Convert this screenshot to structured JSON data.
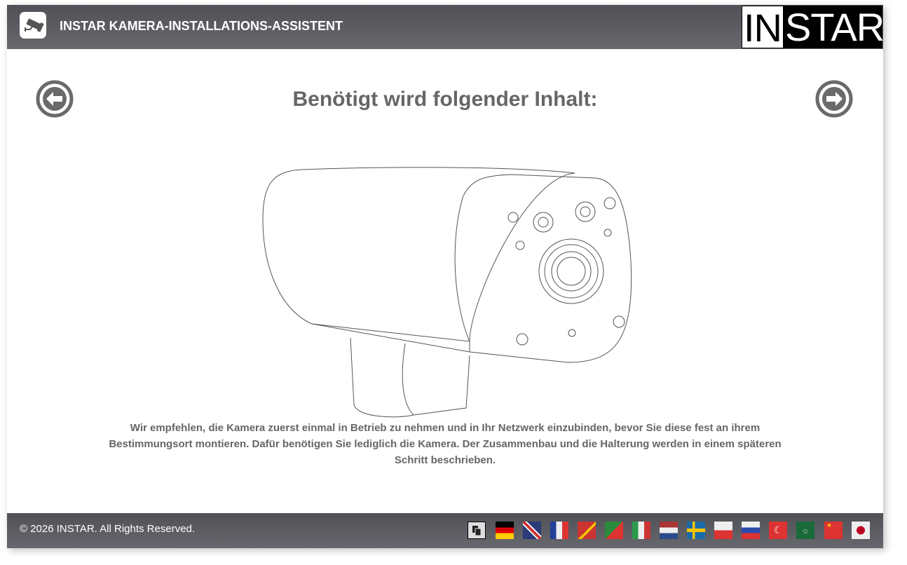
{
  "header": {
    "title": "INSTAR KAMERA-INSTALLATIONS-ASSISTENT",
    "logo_text": "INSTAR",
    "logo_in": "IN",
    "logo_star": "STAR"
  },
  "main": {
    "heading": "Benötigt wird folgender Inhalt:",
    "description": "Wir empfehlen, die Kamera zuerst einmal in Betrieb zu nehmen und in Ihr Netzwerk einzubinden, bevor Sie diese fest an ihrem Bestimmungsort montieren. Dafür benötigen Sie lediglich die Kamera. Der Zusammenbau und die Halterung werden in einem späteren Schritt beschrieben."
  },
  "footer": {
    "copyright": "© 2026 INSTAR. All Rights Reserved.",
    "languages": [
      "copy-icon",
      "german",
      "english",
      "french",
      "spanish",
      "portuguese",
      "italian",
      "dutch",
      "swedish",
      "polish",
      "russian",
      "turkish",
      "arabic",
      "chinese",
      "japanese"
    ]
  },
  "colors": {
    "header": "#5a5b60",
    "text": "#666666",
    "arrow": "#6a6a6a"
  }
}
